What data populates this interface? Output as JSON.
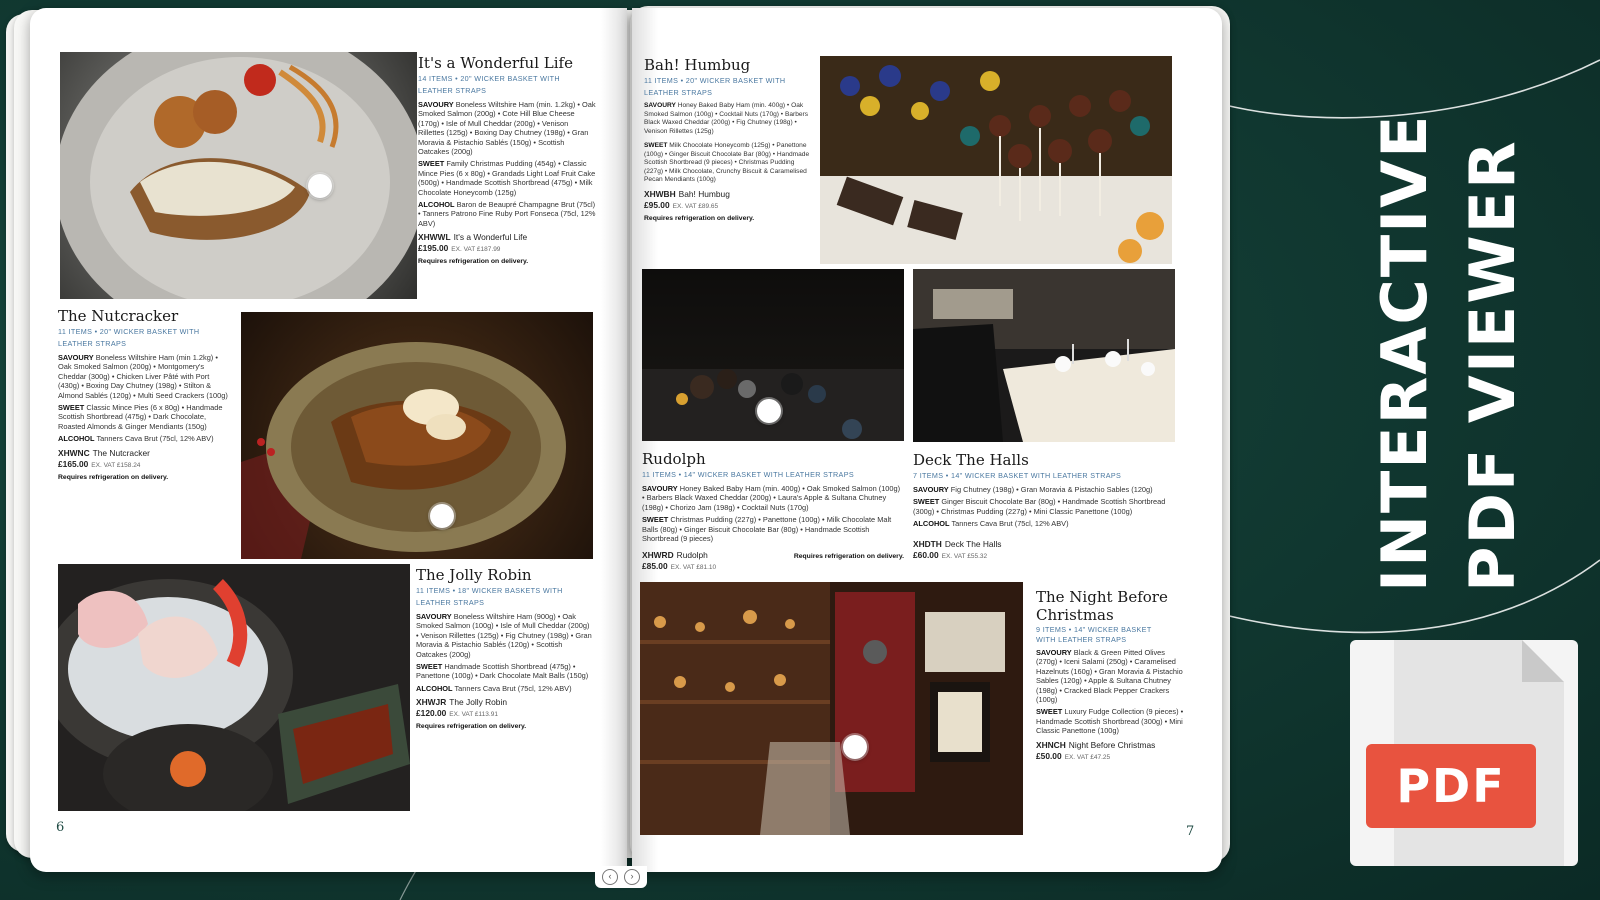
{
  "left_page": {
    "page_number": "6",
    "products": [
      {
        "title": "It's a Wonderful Life",
        "meta_line1": "14 ITEMS • 20\" WICKER BASKET WITH",
        "meta_line2": "LEATHER STRAPS",
        "savoury_label": "SAVOURY",
        "savoury": "Boneless Wiltshire Ham (min. 1.2kg) • Oak Smoked Salmon (200g) • Cote Hill Blue Cheese (170g) • Isle of Mull Cheddar (200g) • Venison Rillettes (125g) • Boxing Day Chutney (198g) • Gran Moravia & Pistachio Sablés (150g) • Scottish Oatcakes (200g)",
        "sweet_label": "SWEET",
        "sweet": "Family Christmas Pudding (454g) • Classic Mince Pies (6 x 80g) • Grandads Light Loaf Fruit Cake (500g) • Handmade Scottish Shortbread (475g) • Milk Chocolate Honeycomb (125g)",
        "alcohol_label": "ALCOHOL",
        "alcohol": "Baron de Beaupré Champagne Brut (75cl) • Tanners Patrono Fine Ruby Port Fonseca (75cl, 12% ABV)",
        "code": "XHWWL",
        "code_name": "It's a Wonderful Life",
        "price": "£195.00",
        "price_ex": "EX. VAT £187.99",
        "note": "Requires refrigeration on delivery."
      },
      {
        "title": "The Nutcracker",
        "meta_line1": "11 ITEMS • 20\" WICKER BASKET WITH",
        "meta_line2": "LEATHER STRAPS",
        "savoury_label": "SAVOURY",
        "savoury": "Boneless Wiltshire Ham (min 1.2kg) • Oak Smoked Salmon (200g) • Montgomery's Cheddar (300g) • Chicken Liver Pâté with Port (430g) • Boxing Day Chutney (198g) • Stilton & Almond Sablés (120g) • Multi Seed Crackers (100g)",
        "sweet_label": "SWEET",
        "sweet": "Classic Mince Pies (6 x 80g) • Handmade Scottish Shortbread (475g) • Dark Chocolate, Roasted Almonds & Ginger Mendiants (150g)",
        "alcohol_label": "ALCOHOL",
        "alcohol": "Tanners Cava Brut (75cl, 12% ABV)",
        "code": "XHWNC",
        "code_name": "The Nutcracker",
        "price": "£165.00",
        "price_ex": "EX. VAT £158.24",
        "note": "Requires refrigeration on delivery."
      },
      {
        "title": "The Jolly Robin",
        "meta_line1": "11 ITEMS • 18\" WICKER BASKETS WITH",
        "meta_line2": "LEATHER STRAPS",
        "savoury_label": "SAVOURY",
        "savoury": "Boneless Wiltshire Ham (900g) • Oak Smoked Salmon (100g) • Isle of Mull Cheddar (200g) • Venison Rillettes (125g) • Fig Chutney (198g) • Gran Moravia & Pistachio Sablés (120g) • Scottish Oatcakes (200g)",
        "sweet_label": "SWEET",
        "sweet": "Handmade Scottish Shortbread (475g) • Panettone (100g) • Dark Chocolate Malt Balls (150g)",
        "alcohol_label": "ALCOHOL",
        "alcohol": "Tanners Cava Brut (75cl, 12% ABV)",
        "code": "XHWJR",
        "code_name": "The Jolly Robin",
        "price": "£120.00",
        "price_ex": "EX. VAT £113.91",
        "note": "Requires refrigeration on delivery."
      }
    ]
  },
  "right_page": {
    "page_number": "7",
    "products": [
      {
        "title": "Bah! Humbug",
        "meta_line1": "11 ITEMS • 20\" WICKER BASKET WITH",
        "meta_line2": "LEATHER STRAPS",
        "savoury_label": "SAVOURY",
        "savoury": "Honey Baked Baby Ham (min. 400g) • Oak Smoked Salmon (100g) • Cocktail Nuts (170g) • Barbers Black Waxed Cheddar (200g) • Fig Chutney (198g) • Venison Rillettes (125g)",
        "sweet_label": "SWEET",
        "sweet": "Milk Chocolate Honeycomb (125g) • Panettone (100g) • Ginger Biscuit Chocolate Bar (80g) • Handmade Scottish Shortbread (9 pieces) • Christmas Pudding (227g) • Milk Chocolate, Crunchy Biscuit & Caramelised Pecan Mendiants (100g)",
        "code": "XHWBH",
        "code_name": "Bah! Humbug",
        "price": "£95.00",
        "price_ex": "EX. VAT £89.65",
        "note": "Requires refrigeration on delivery."
      },
      {
        "title": "Rudolph",
        "meta_line1": "11 ITEMS • 14\" WICKER BASKET WITH LEATHER STRAPS",
        "savoury_label": "SAVOURY",
        "savoury": "Honey Baked Baby Ham (min. 400g) • Oak Smoked Salmon (100g) • Barbers Black Waxed Cheddar (200g) • Laura's Apple & Sultana Chutney (198g) • Chorizo Jam (198g) • Cocktail Nuts (170g)",
        "sweet_label": "SWEET",
        "sweet": "Christmas Pudding (227g) • Panettone (100g) • Milk Chocolate Malt Balls (80g) • Ginger Biscuit Chocolate Bar (80g) • Handmade Scottish Shortbread (9 pieces)",
        "code": "XHWRD",
        "code_name": "Rudolph",
        "price": "£85.00",
        "price_ex": "EX. VAT £81.10",
        "note": "Requires refrigeration on delivery."
      },
      {
        "title": "Deck The Halls",
        "meta_line1": "7 ITEMS • 14\" WICKER BASKET WITH LEATHER STRAPS",
        "savoury_label": "SAVOURY",
        "savoury": "Fig Chutney (198g) • Gran Moravia & Pistachio Sables (120g)",
        "sweet_label": "SWEET",
        "sweet": "Ginger Biscuit Chocolate Bar (80g) • Handmade Scottish Shortbread (300g) • Christmas Pudding (227g) • Mini Classic Panettone (100g)",
        "alcohol_label": "ALCOHOL",
        "alcohol": "Tanners Cava Brut (75cl, 12% ABV)",
        "code": "XHDTH",
        "code_name": "Deck The Halls",
        "price": "£60.00",
        "price_ex": "EX. VAT £55.32"
      },
      {
        "title_line1": "The Night Before",
        "title_line2": "Christmas",
        "meta_line1": "9 ITEMS • 14\" WICKER BASKET",
        "meta_line2": "WITH LEATHER STRAPS",
        "savoury_label": "SAVOURY",
        "savoury": "Black & Green Pitted Olives (270g) • Iceni Salami (250g) • Caramelised Hazelnuts (160g) • Gran Moravia & Pistachio Sables (120g) • Apple & Sultana Chutney (198g) • Cracked Black Pepper Crackers (100g)",
        "sweet_label": "SWEET",
        "sweet": "Luxury Fudge Collection (9 pieces) • Handmade Scottish Shortbread (300g) • Mini Classic Panettone (100g)",
        "code": "XHNCH",
        "code_name": "Night Before Christmas",
        "price": "£50.00",
        "price_ex": "EX. VAT £47.25"
      }
    ]
  },
  "headline": {
    "line1": "INTERACTIVE",
    "line2": "PDF VIEWER"
  },
  "badge": {
    "label": "PDF"
  },
  "nav": {
    "prev": "‹",
    "next": "›"
  },
  "colors": {
    "background": "#123b33",
    "accent": "#e8533f",
    "meta_text": "#4a78a0"
  }
}
